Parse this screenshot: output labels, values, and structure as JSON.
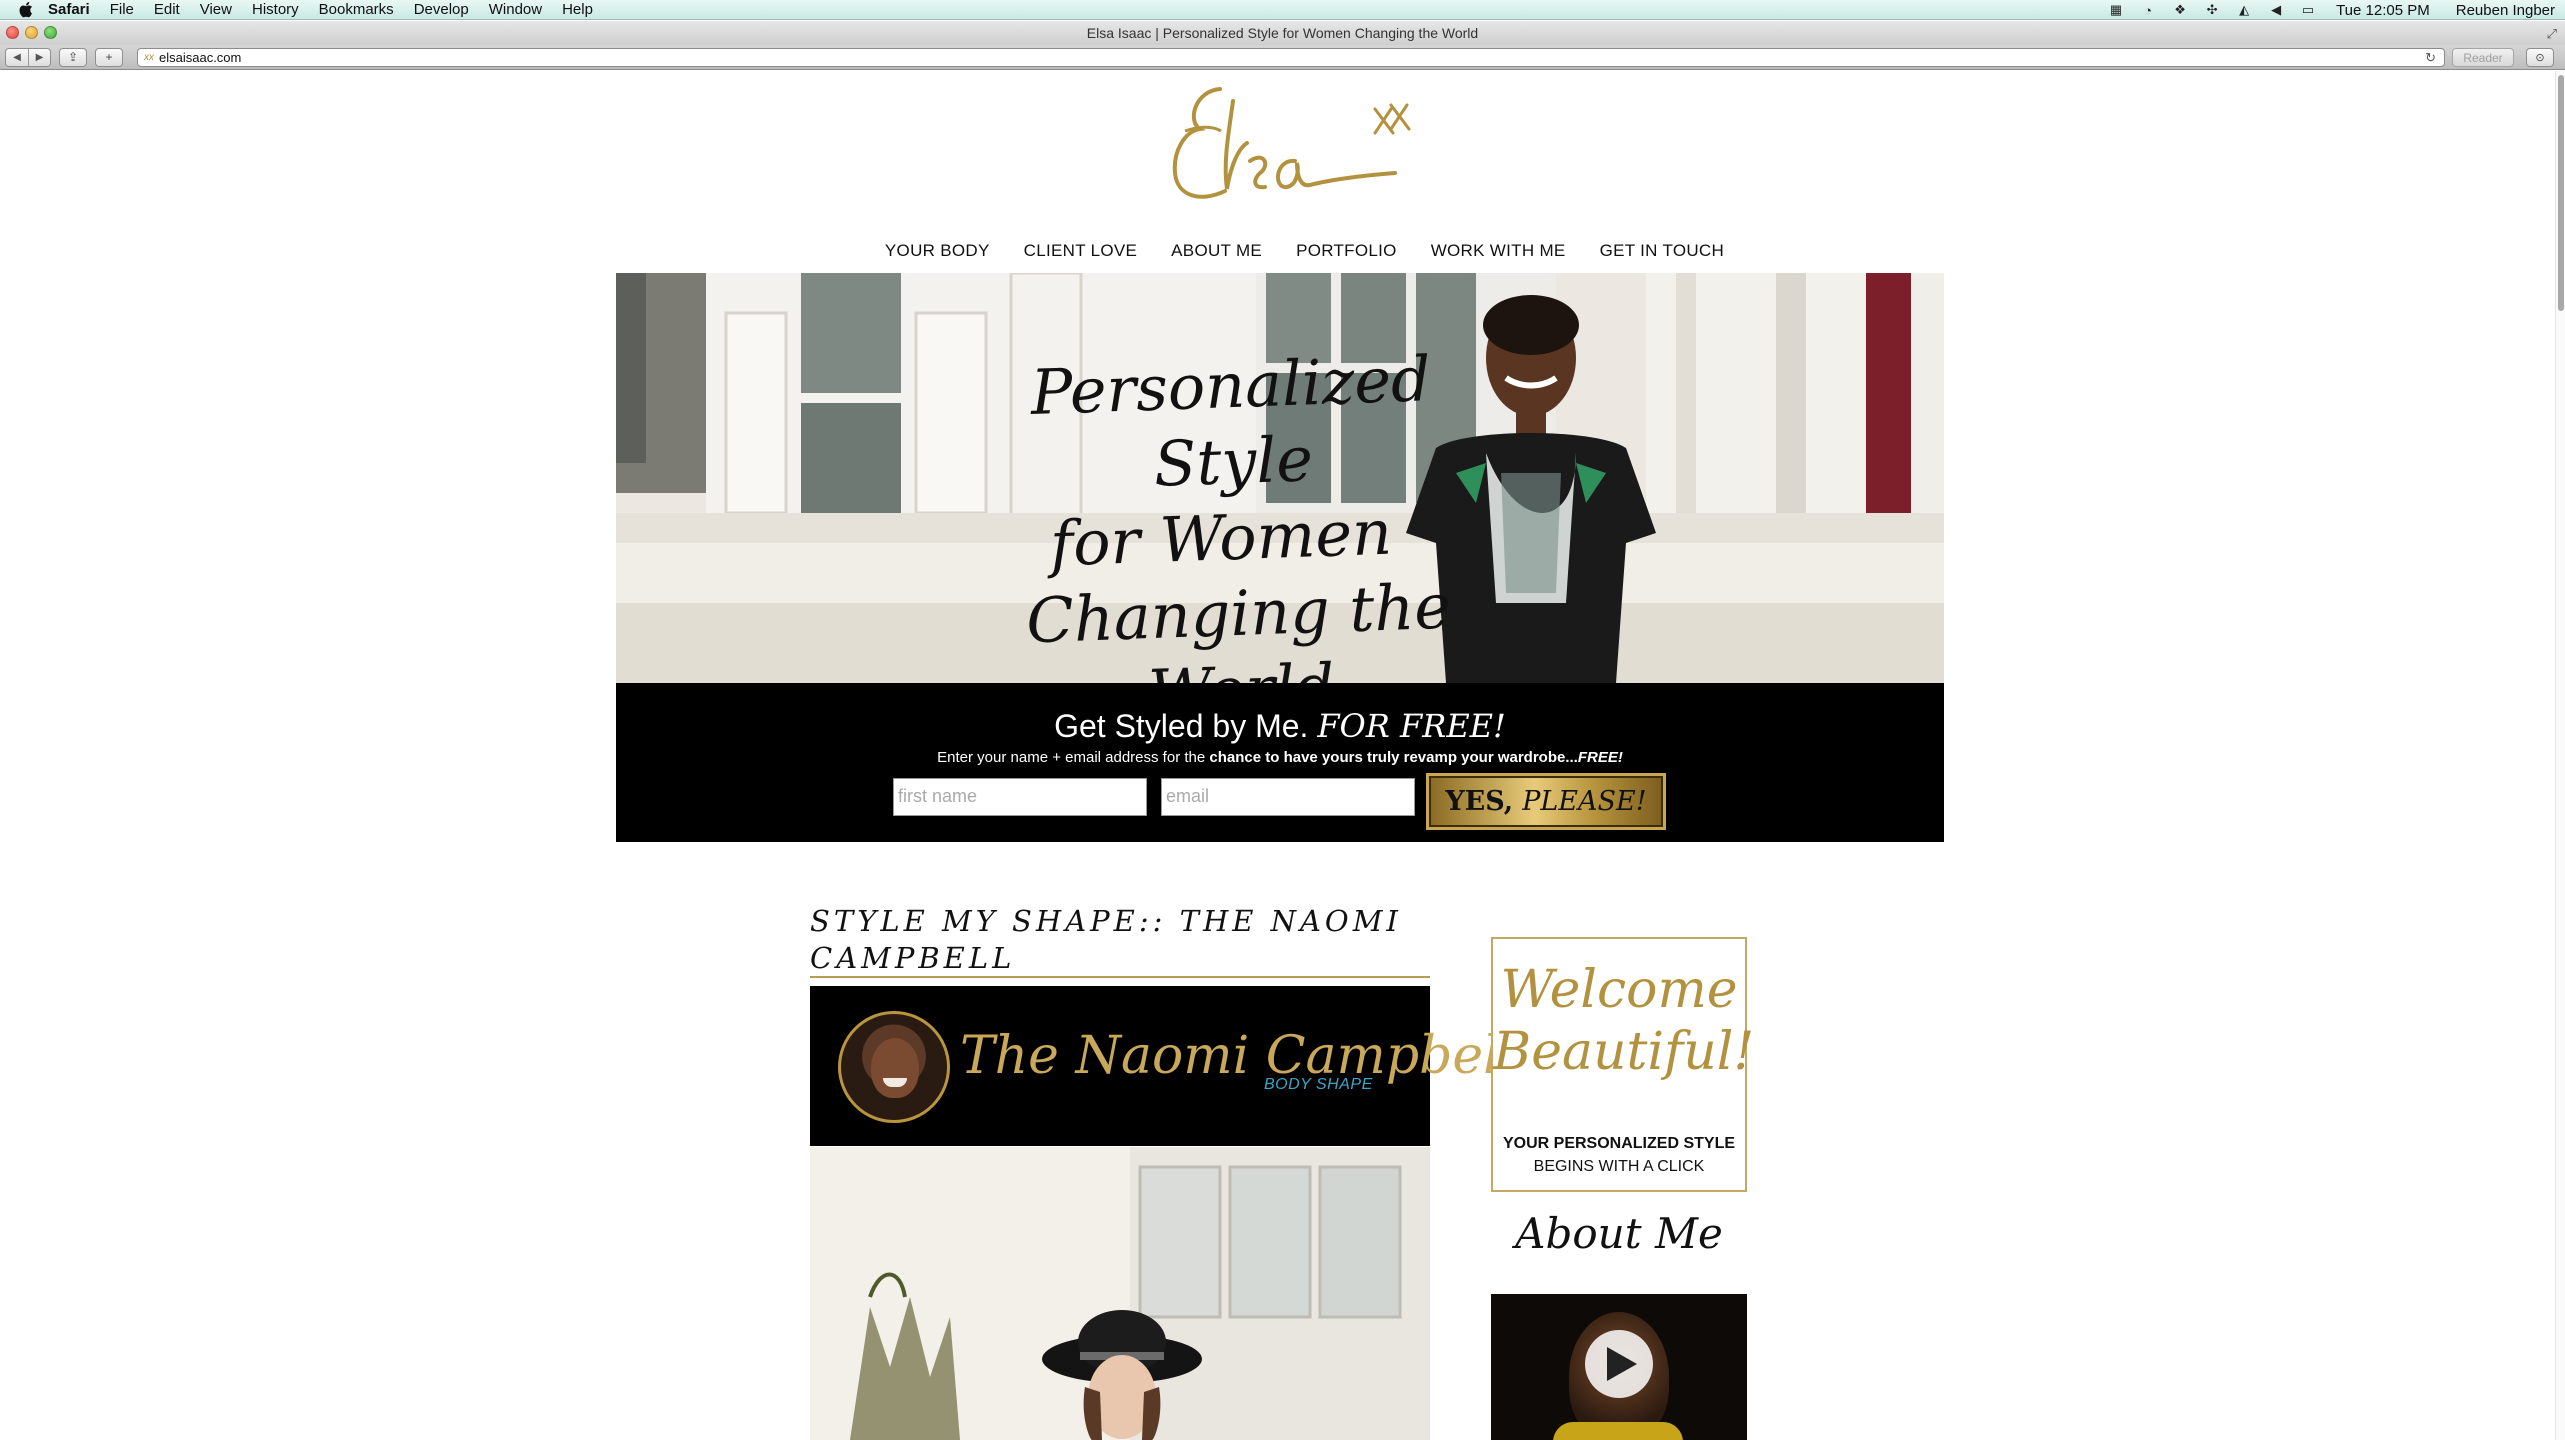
{
  "menubar": {
    "app": "Safari",
    "items": [
      "File",
      "Edit",
      "View",
      "History",
      "Bookmarks",
      "Develop",
      "Window",
      "Help"
    ],
    "clock": "Tue 12:05 PM",
    "user": "Reuben Ingber"
  },
  "browser": {
    "title": "Elsa Isaac | Personalized Style for Women Changing the World",
    "url": "elsaisaac.com",
    "reader_label": "Reader"
  },
  "site": {
    "logo_text": "Elsa",
    "logo_mark": "xx",
    "nav": [
      "YOUR BODY",
      "CLIENT LOVE",
      "ABOUT ME",
      "PORTFOLIO",
      "WORK WITH ME",
      "GET IN TOUCH"
    ],
    "hero": {
      "line1": "Personalized Style",
      "line2": "for Women",
      "line3": "Changing the World"
    },
    "optin": {
      "title_main": "Get Styled by Me.",
      "title_emph": "FOR FREE!",
      "sub_prefix": "Enter your name + email address for the",
      "sub_bold": "chance to have yours truly revamp your wardrobe...",
      "sub_free": "FREE!",
      "name_placeholder": "first name",
      "email_placeholder": "email",
      "button_main": "YES,",
      "button_emph": "PLEASE!"
    },
    "post": {
      "title": "STYLE MY SHAPE:: THE NAOMI CAMPBELL",
      "banner_script": "The Naomi Campbell",
      "banner_sub": "BODY SHAPE"
    },
    "sidebar": {
      "welcome_line1": "Welcome",
      "welcome_line2": "Beautiful!",
      "cta_bold": "YOUR PERSONALIZED STYLE",
      "cta_rest": "BEGINS WITH A CLICK",
      "about_title": "About Me"
    }
  },
  "colors": {
    "gold": "#b3923f",
    "optin_bg": "#000000",
    "banner_sub": "#3aa7c9"
  }
}
